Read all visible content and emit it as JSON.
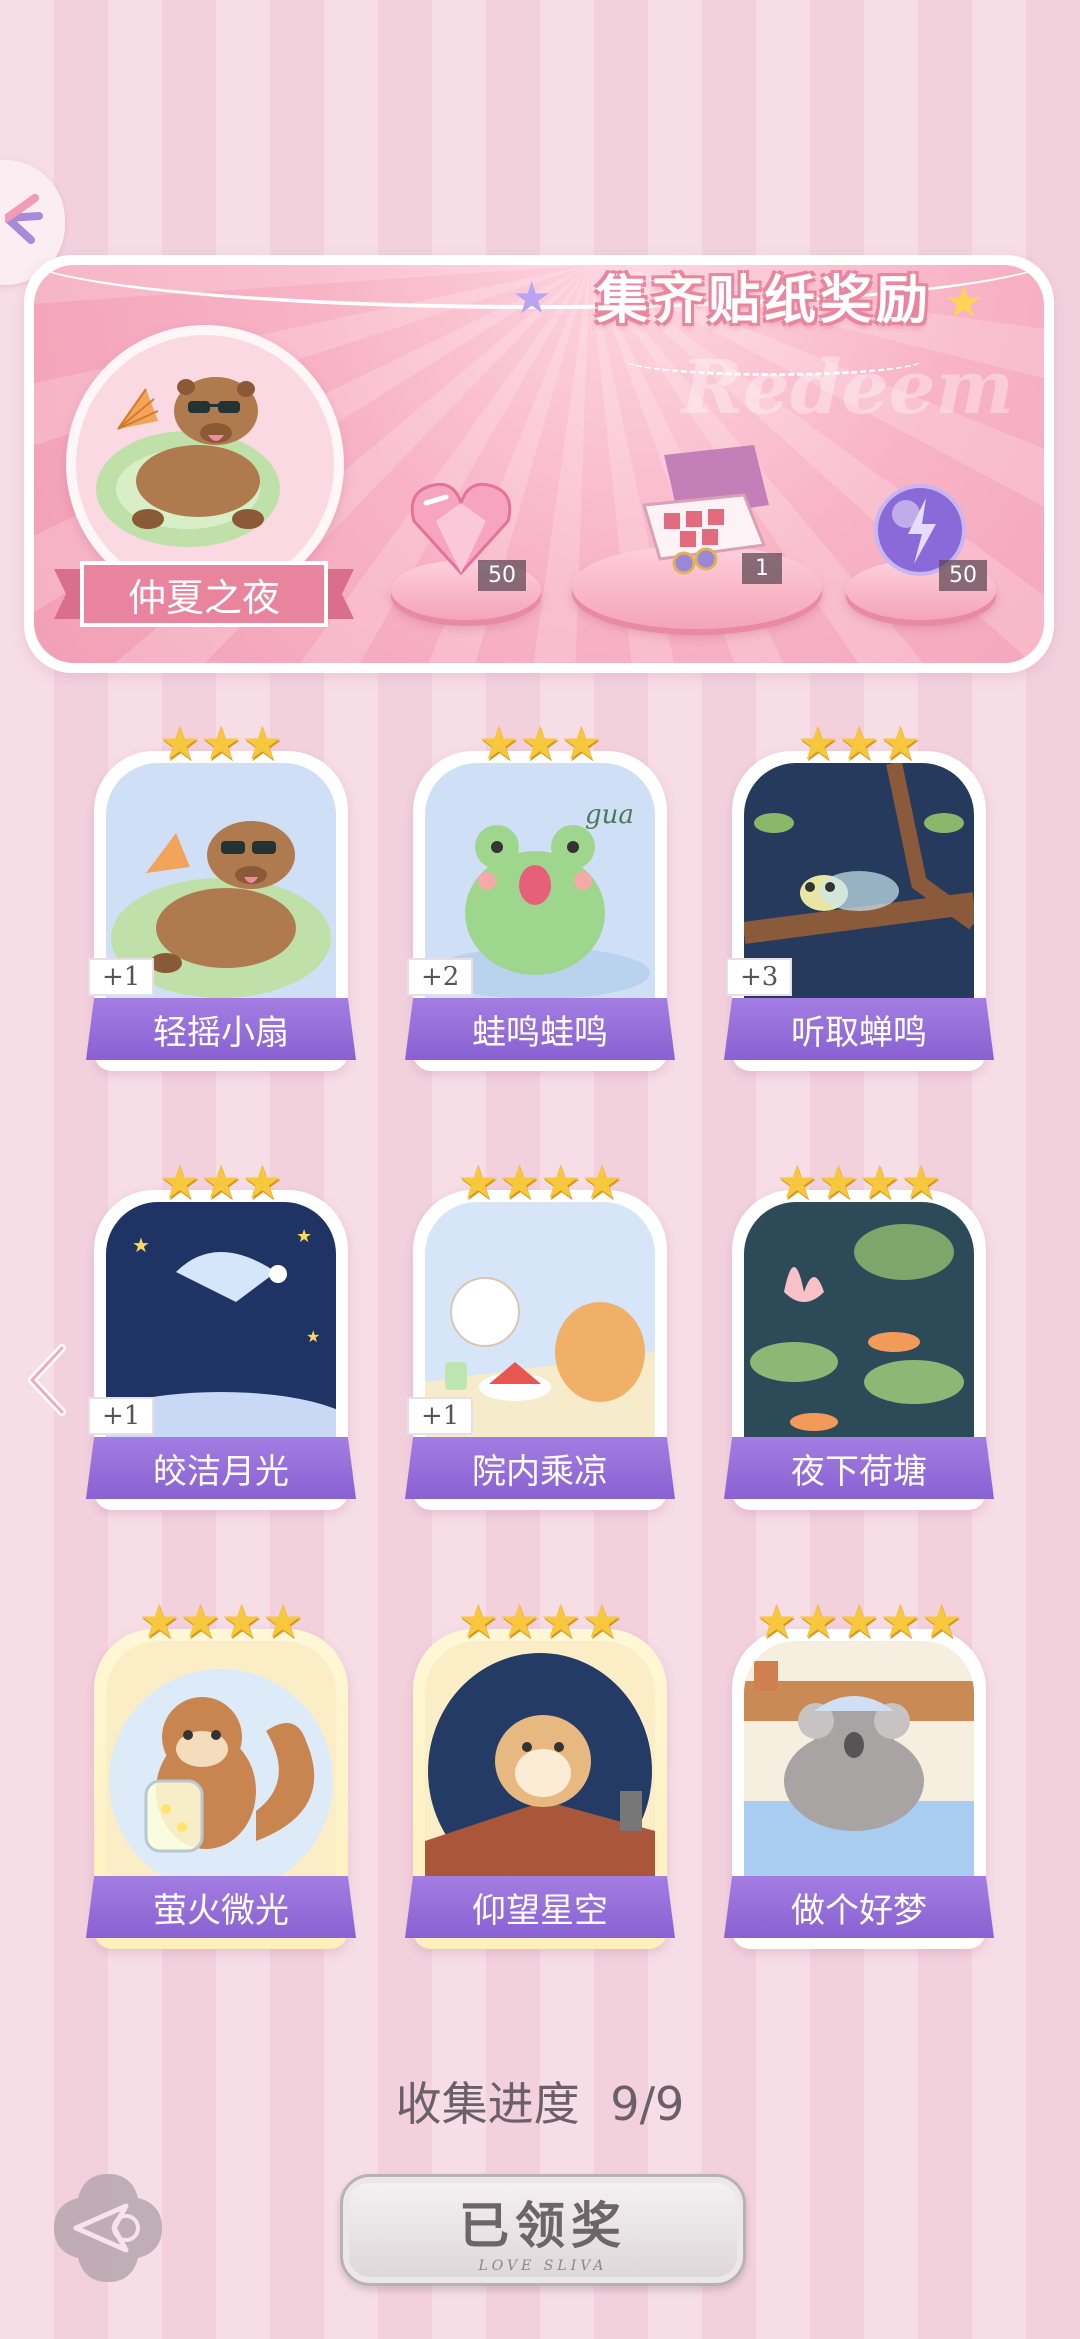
{
  "banner": {
    "title": "集齐贴纸奖励",
    "watermark": "Redeem",
    "collection_name": "仲夏之夜",
    "rewards": [
      {
        "icon": "pink-heart-gem-icon",
        "count": "50"
      },
      {
        "icon": "gift-box-icon",
        "count": "1"
      },
      {
        "icon": "purple-lightning-orb-icon",
        "count": "50"
      }
    ]
  },
  "stickers": [
    {
      "name": "轻摇小扇",
      "stars": 3,
      "extra": "+1",
      "art": "capybara-fan"
    },
    {
      "name": "蛙鸣蛙鸣",
      "stars": 3,
      "extra": "+2",
      "art": "frog-gua",
      "art_text": "gua"
    },
    {
      "name": "听取蝉鸣",
      "stars": 3,
      "extra": "+3",
      "art": "cicada-tree"
    },
    {
      "name": "皎洁月光",
      "stars": 3,
      "extra": "+1",
      "art": "moon-sleep"
    },
    {
      "name": "院内乘凉",
      "stars": 4,
      "extra": "+1",
      "art": "cats-watermelon"
    },
    {
      "name": "夜下荷塘",
      "stars": 4,
      "extra": "",
      "art": "lotus-pond"
    },
    {
      "name": "萤火微光",
      "stars": 4,
      "extra": "",
      "art": "squirrel-firefly"
    },
    {
      "name": "仰望星空",
      "stars": 4,
      "extra": "",
      "art": "hamster-roof"
    },
    {
      "name": "做个好梦",
      "stars": 5,
      "extra": "",
      "art": "koala-bed"
    }
  ],
  "progress": {
    "label": "收集进度",
    "value": "9/9"
  },
  "claim_button": {
    "label": "已领奖",
    "sub": "LOVE SLIVA"
  },
  "colors": {
    "accent_purple": "#8a61d2",
    "pink": "#e8849e",
    "star_gold": "#f7c73d"
  }
}
